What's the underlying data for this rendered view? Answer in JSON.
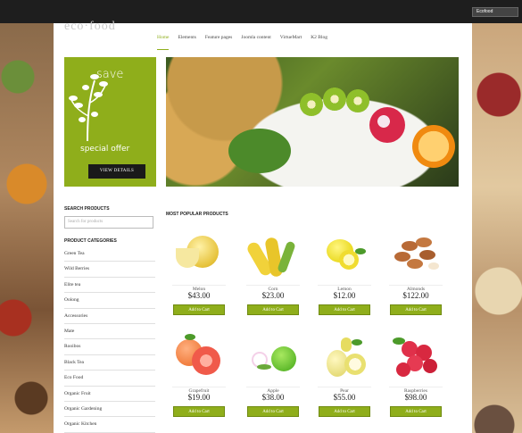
{
  "lang": {
    "value": "Ecofood"
  },
  "logo": {
    "text": "eco·food"
  },
  "nav": [
    {
      "label": "Home",
      "active": true
    },
    {
      "label": "Elements"
    },
    {
      "label": "Feature pages"
    },
    {
      "label": "Joomla content"
    },
    {
      "label": "VirtueMart"
    },
    {
      "label": "K2 Blog"
    }
  ],
  "promo": {
    "save": "save",
    "special": "special offer",
    "button": "VIEW DETAILS",
    "bg": "#8fae1b"
  },
  "search": {
    "title": "SEARCH PRODUCTS",
    "placeholder": "Search for products"
  },
  "categories": {
    "title": "PRODUCT CATEGORIES",
    "items": [
      "Green Tea",
      "Wild Berries",
      "Elite tea",
      "Oolong",
      "Accessories",
      "Mate",
      "Rooibos",
      "Black Tea",
      "Eco Food",
      "Organic Fruit",
      "Organic Gardening",
      "Organic Kitchen"
    ]
  },
  "popular": {
    "title": "MOST POPULAR PRODUCTS"
  },
  "products": [
    {
      "name": "Melon",
      "price": "$43.00",
      "cart": "Add to Cart",
      "icon": "melon-icon"
    },
    {
      "name": "Corn",
      "price": "$23.00",
      "cart": "Add to Cart",
      "icon": "corn-icon"
    },
    {
      "name": "Lemon",
      "price": "$12.00",
      "cart": "Add to Cart",
      "icon": "lemon-icon"
    },
    {
      "name": "Almonds",
      "price": "$122.00",
      "cart": "Add to Cart",
      "icon": "almonds-icon"
    },
    {
      "name": "Grapefruit",
      "price": "$19.00",
      "cart": "Add to Cart",
      "icon": "grapefruit-icon"
    },
    {
      "name": "Apple",
      "price": "$38.00",
      "cart": "Add to Cart",
      "icon": "apple-icon"
    },
    {
      "name": "Pear",
      "price": "$55.00",
      "cart": "Add to Cart",
      "icon": "pear-icon"
    },
    {
      "name": "Raspberries",
      "price": "$98.00",
      "cart": "Add to Cart",
      "icon": "raspberries-icon"
    }
  ],
  "colors": {
    "accent": "#8fae1b",
    "topbar": "#1e1e1e",
    "button_dark": "#1a1a1a"
  }
}
